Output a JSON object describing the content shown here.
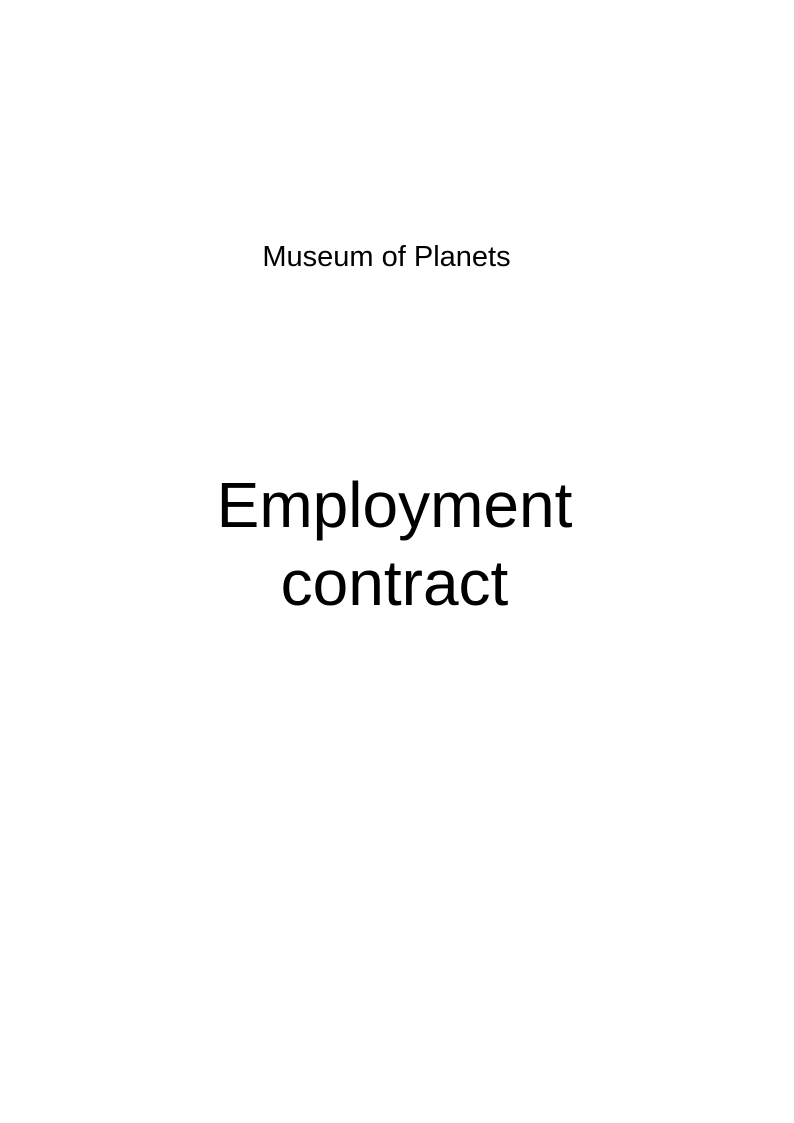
{
  "document": {
    "organization": "Museum of Planets",
    "title_line_1": "Employment",
    "title_line_2": "contract"
  }
}
